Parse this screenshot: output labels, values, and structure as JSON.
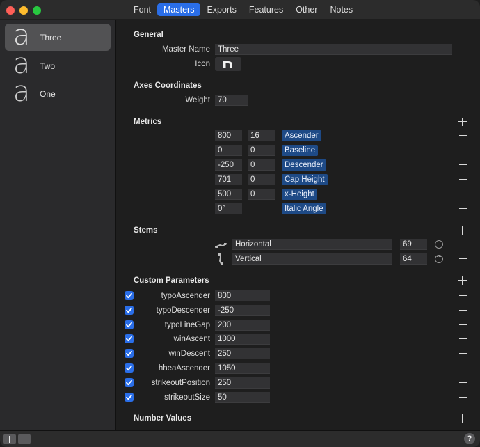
{
  "window": {
    "tabs": [
      {
        "label": "Font",
        "active": false
      },
      {
        "label": "Masters",
        "active": true
      },
      {
        "label": "Exports",
        "active": false
      },
      {
        "label": "Features",
        "active": false
      },
      {
        "label": "Other",
        "active": false
      },
      {
        "label": "Notes",
        "active": false
      }
    ]
  },
  "sidebar": {
    "masters": [
      {
        "glyph": "a",
        "name": "Three",
        "selected": true
      },
      {
        "glyph": "a",
        "name": "Two",
        "selected": false
      },
      {
        "glyph": "a",
        "name": "One",
        "selected": false
      }
    ]
  },
  "general": {
    "title": "General",
    "master_name_label": "Master Name",
    "master_name_value": "Three",
    "icon_label": "Icon",
    "icon_glyph": "n"
  },
  "axes": {
    "title": "Axes Coordinates",
    "rows": [
      {
        "label": "Weight",
        "value": "70"
      }
    ]
  },
  "metrics": {
    "title": "Metrics",
    "rows": [
      {
        "value": "800",
        "overshoot": "16",
        "name": "Ascender"
      },
      {
        "value": "0",
        "overshoot": "0",
        "name": "Baseline"
      },
      {
        "value": "-250",
        "overshoot": "0",
        "name": "Descender"
      },
      {
        "value": "701",
        "overshoot": "0",
        "name": "Cap Height"
      },
      {
        "value": "500",
        "overshoot": "0",
        "name": "x-Height"
      },
      {
        "value": "0°",
        "overshoot": null,
        "name": "Italic Angle"
      }
    ]
  },
  "stems": {
    "title": "Stems",
    "rows": [
      {
        "icon": "horizontal-stem-icon",
        "name": "Horizontal",
        "value": "69"
      },
      {
        "icon": "vertical-stem-icon",
        "name": "Vertical",
        "value": "64"
      }
    ]
  },
  "custom_parameters": {
    "title": "Custom Parameters",
    "rows": [
      {
        "enabled": true,
        "name": "typoAscender",
        "value": "800"
      },
      {
        "enabled": true,
        "name": "typoDescender",
        "value": "-250"
      },
      {
        "enabled": true,
        "name": "typoLineGap",
        "value": "200"
      },
      {
        "enabled": true,
        "name": "winAscent",
        "value": "1000"
      },
      {
        "enabled": true,
        "name": "winDescent",
        "value": "250"
      },
      {
        "enabled": true,
        "name": "hheaAscender",
        "value": "1050"
      },
      {
        "enabled": true,
        "name": "strikeoutPosition",
        "value": "250"
      },
      {
        "enabled": true,
        "name": "strikeoutSize",
        "value": "50"
      }
    ]
  },
  "number_values": {
    "title": "Number Values"
  },
  "bottombar": {
    "help_label": "?"
  }
}
